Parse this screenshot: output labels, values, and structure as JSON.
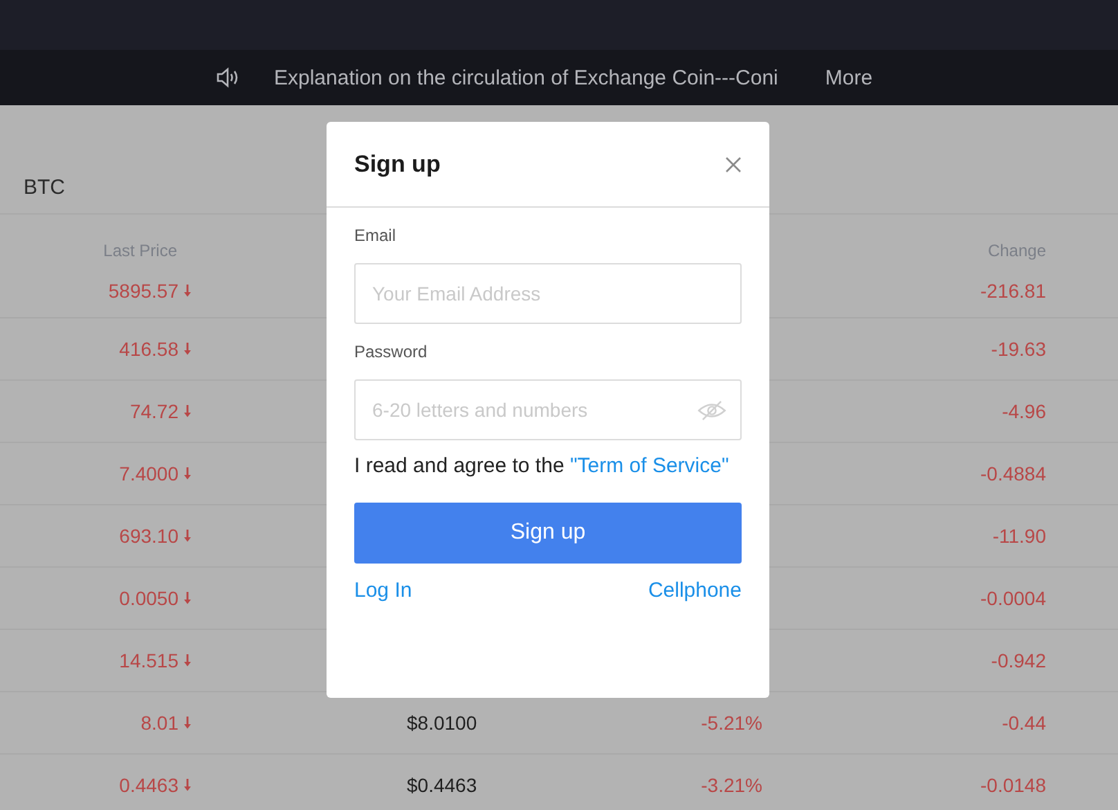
{
  "notice": {
    "text": "Explanation on the circulation of Exchange Coin---Coni",
    "more": "More"
  },
  "market": {
    "title": "BTC",
    "columns": {
      "last_price": "Last Price",
      "change": "Change"
    },
    "rows": [
      {
        "kind": "down",
        "last_price": "5895.57",
        "change": "-216.81"
      },
      {
        "kind": "down",
        "last_price": "416.58",
        "change": "-19.63"
      },
      {
        "kind": "down",
        "last_price": "74.72",
        "change": "-4.96"
      },
      {
        "kind": "down",
        "last_price": "7.4000",
        "change": "-0.4884"
      },
      {
        "kind": "down",
        "last_price": "693.10",
        "change": "-11.90"
      },
      {
        "kind": "down",
        "last_price": "0.0050",
        "change": "-0.0004"
      },
      {
        "kind": "down",
        "last_price": "14.515",
        "change": "-0.942"
      },
      {
        "kind": "down",
        "last_price": "8.01",
        "usd_price": "$8.0100",
        "change_percent": "-5.21%",
        "change": "-0.44"
      },
      {
        "kind": "down",
        "last_price": "0.4463",
        "usd_price": "$0.4463",
        "change_percent": "-3.21%",
        "change": "-0.0148"
      }
    ]
  },
  "dialog": {
    "title": "Sign up",
    "fields": [
      {
        "kind": "text",
        "label": "Email",
        "placeholder": "Your Email Address"
      },
      {
        "kind": "password",
        "label": "Password",
        "placeholder": "6-20 letters and numbers"
      }
    ],
    "agreement": {
      "text": "I read and agree to the",
      "link": "\"Term of Service\""
    },
    "submit": "Sign up",
    "links": [
      "Log In",
      "Cellphone"
    ]
  }
}
